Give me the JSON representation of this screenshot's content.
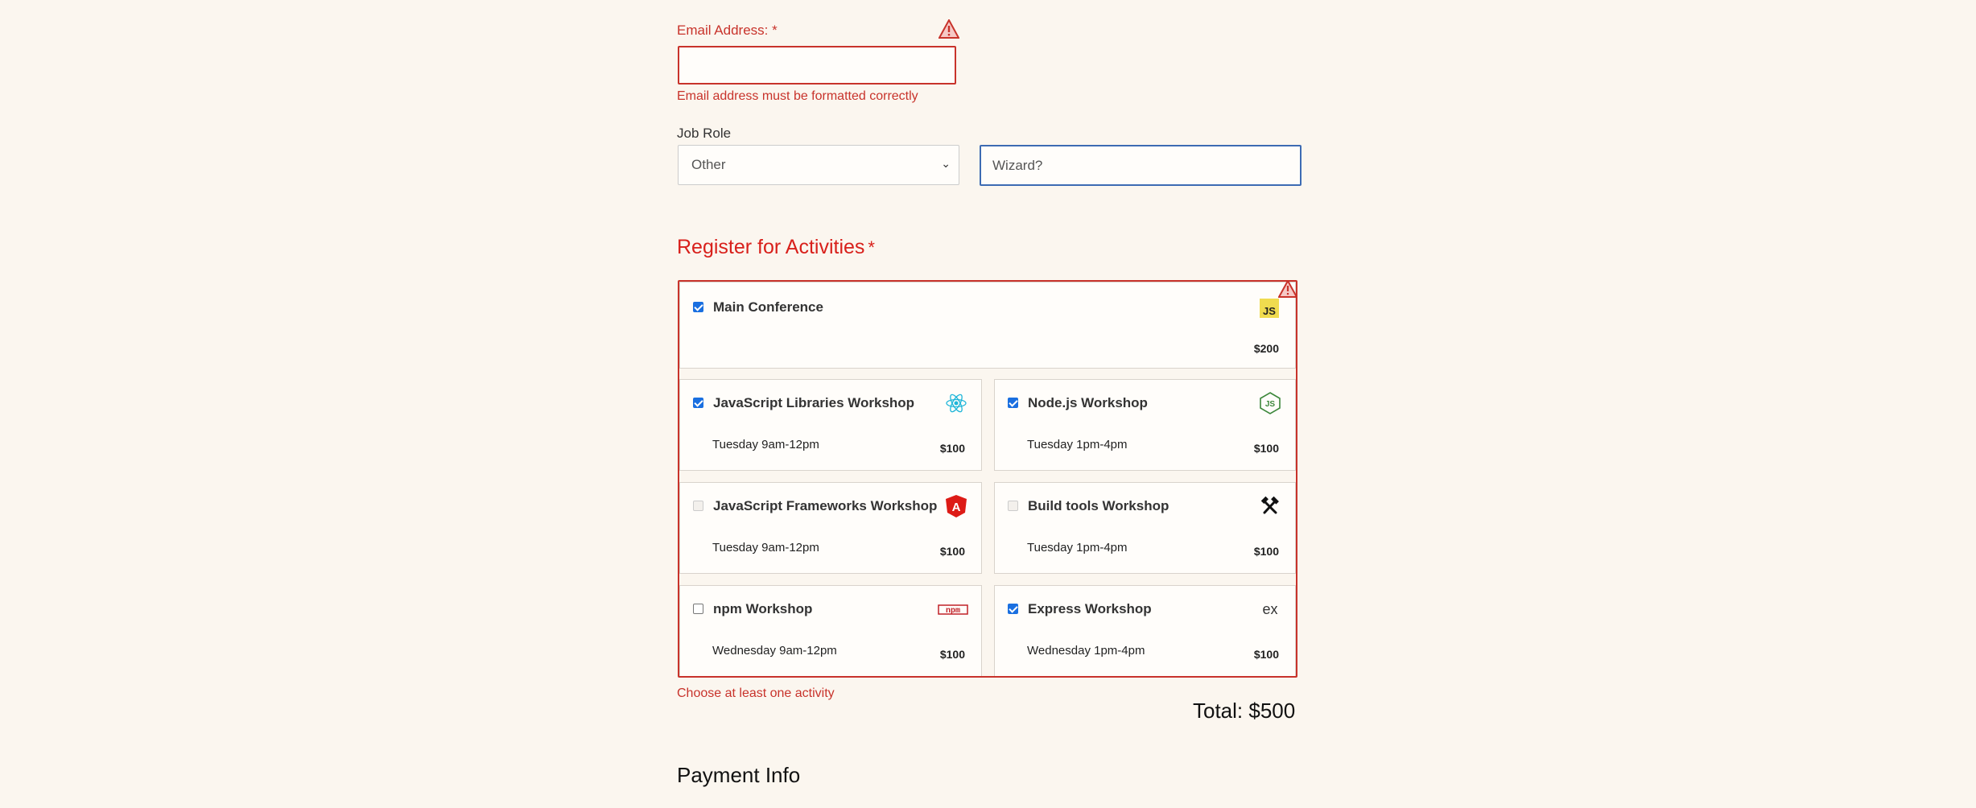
{
  "email": {
    "label": "Email Address: *",
    "value": "",
    "error": "Email address must be formatted correctly"
  },
  "job": {
    "label": "Job Role",
    "selected": "Other",
    "other_value": "Wizard?"
  },
  "activities": {
    "title": "Register for Activities",
    "required_mark": "*",
    "items": [
      {
        "title": "Main Conference",
        "time": "",
        "price": "$200",
        "checked": true,
        "icon": "js-icon"
      },
      {
        "title": "JavaScript Libraries Workshop",
        "time": "Tuesday 9am-12pm",
        "price": "$100",
        "checked": true,
        "icon": "react-icon"
      },
      {
        "title": "Node.js Workshop",
        "time": "Tuesday 1pm-4pm",
        "price": "$100",
        "checked": true,
        "icon": "nodejs-icon"
      },
      {
        "title": "JavaScript Frameworks Workshop",
        "time": "Tuesday 9am-12pm",
        "price": "$100",
        "checked": false,
        "disabled": true,
        "icon": "angular-icon"
      },
      {
        "title": "Build tools Workshop",
        "time": "Tuesday 1pm-4pm",
        "price": "$100",
        "checked": false,
        "disabled": true,
        "icon": "build-tools-icon"
      },
      {
        "title": "npm Workshop",
        "time": "Wednesday 9am-12pm",
        "price": "$100",
        "checked": false,
        "icon": "npm-icon"
      },
      {
        "title": "Express Workshop",
        "time": "Wednesday 1pm-4pm",
        "price": "$100",
        "checked": true,
        "icon": "express-icon"
      }
    ],
    "error": "Choose at least one activity",
    "total": "Total: $500"
  },
  "payment": {
    "title": "Payment Info"
  },
  "colors": {
    "error": "#c8332b",
    "title_red": "#d8201b",
    "focus_blue": "#3d6bb3",
    "check_blue": "#1a6fe0"
  }
}
